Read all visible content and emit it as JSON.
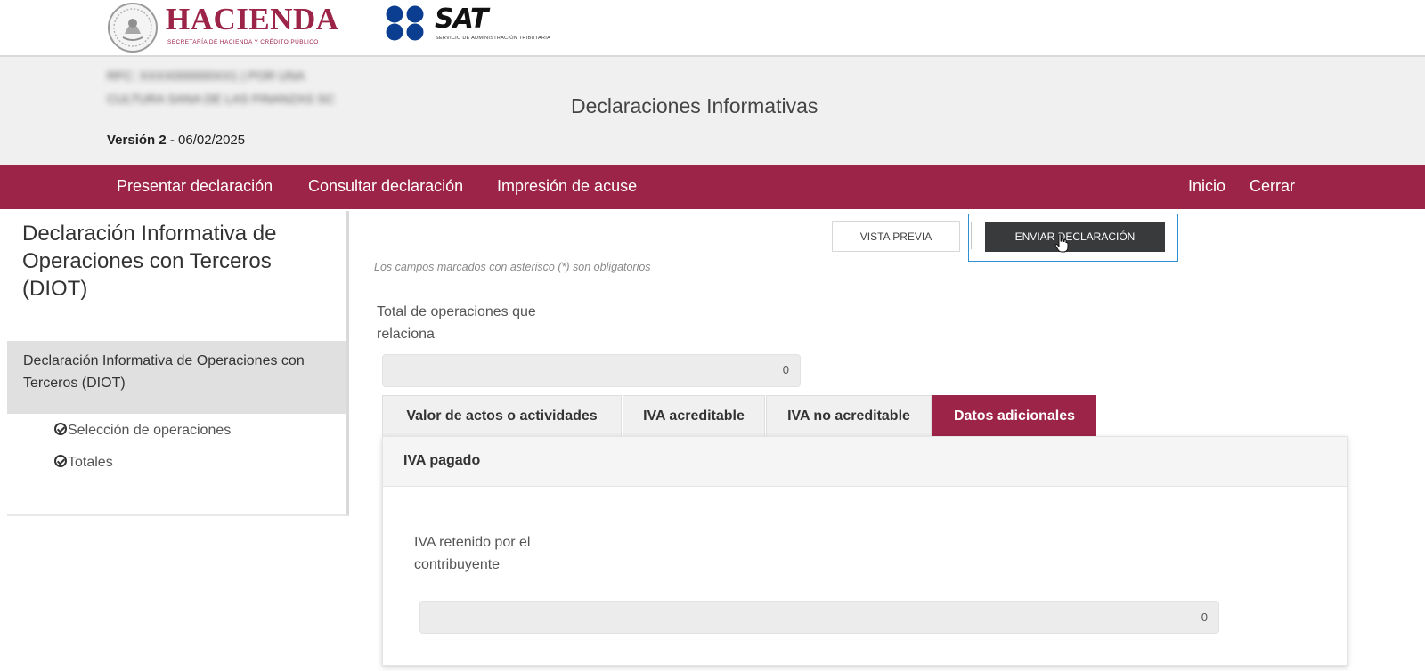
{
  "brand": {
    "hacienda_word": "HACIENDA",
    "hacienda_sub": "SECRETARÍA DE HACIENDA Y CRÉDITO PÚBLICO",
    "sat_word": "SAT",
    "sat_sub": "SERVICIO DE ADMINISTRACIÓN TRIBUTARIA",
    "maroon": "#9d2449",
    "sat_blue": "#0b3d91"
  },
  "header": {
    "rfc_blurred": "RFC: XXXX000000XX1 | POR UNA CULTURA SANA DE LAS FINANZAS SC",
    "version_label": "Versión 2",
    "version_sep": " - ",
    "version_date": "06/02/2025",
    "title": "Declaraciones Informativas"
  },
  "nav": {
    "presentar": "Presentar declaración",
    "consultar": "Consultar declaración",
    "impresion": "Impresión de acuse",
    "inicio": "Inicio",
    "cerrar": "Cerrar"
  },
  "sidebar": {
    "title": "Declaración Informativa de Operaciones con Terceros (DIOT)",
    "section": "Declaración Informativa de Operaciones con Terceros (DIOT)",
    "items": [
      {
        "label": "Selección de operaciones",
        "icon": "check-circle-icon"
      },
      {
        "label": "Totales",
        "icon": "check-circle-icon"
      }
    ]
  },
  "actions": {
    "vista_previa": "VISTA PREVIA",
    "enviar": "ENVIAR DECLARACIÓN"
  },
  "form": {
    "required_note": "Los campos marcados con asterisco (*) son obligatorios",
    "total_label": "Total de operaciones que relaciona",
    "total_value": "0"
  },
  "tabs": [
    {
      "label": "Valor de actos o actividades",
      "active": false
    },
    {
      "label": "IVA acreditable",
      "active": false
    },
    {
      "label": "IVA no acreditable",
      "active": false
    },
    {
      "label": "Datos adicionales",
      "active": true
    }
  ],
  "panel": {
    "title": "IVA pagado",
    "iva_retenido_label": "IVA retenido por el contribuyente",
    "iva_retenido_value": "0"
  }
}
